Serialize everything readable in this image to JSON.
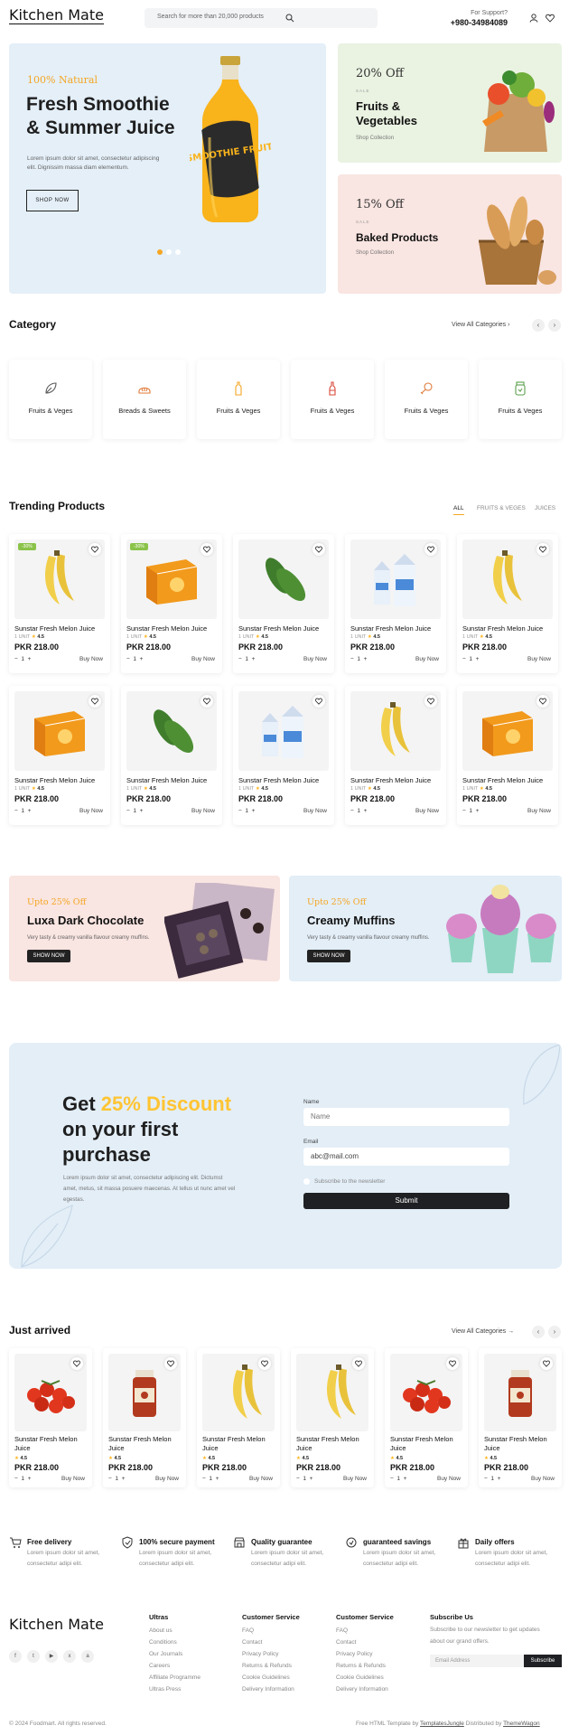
{
  "header": {
    "logo": "Kitchen Mate",
    "search_placeholder": "Search for more than 20,000 products",
    "support_label": "For Support?",
    "support_phone": "+980-34984089"
  },
  "hero": {
    "kicker": "100% Natural",
    "title_line1": "Fresh Smoothie",
    "title_line2": "& Summer Juice",
    "desc_line1": "Lorem ipsum dolor sit amet, consectetur adipiscing",
    "desc_line2": "elit. Dignissim massa diam elementum.",
    "cta": "SHOP NOW",
    "bottle_text": "SMOOTHIE FRUIT"
  },
  "promos": [
    {
      "off": "20% Off",
      "sale": "SALE",
      "title_line1": "Fruits &",
      "title_line2": "Vegetables",
      "link": "Shop Collection"
    },
    {
      "off": "15% Off",
      "sale": "SALE",
      "title_line1": "Baked Products",
      "title_line2": "",
      "link": "Shop Collection"
    }
  ],
  "category": {
    "title": "Category",
    "view_all": "View All Categories",
    "items": [
      {
        "label": "Fruits & Veges",
        "icon": "leaf-icon"
      },
      {
        "label": "Breads & Sweets",
        "icon": "bread-icon"
      },
      {
        "label": "Fruits & Veges",
        "icon": "bottle-icon"
      },
      {
        "label": "Fruits & Veges",
        "icon": "wine-icon"
      },
      {
        "label": "Fruits & Veges",
        "icon": "drumstick-icon"
      },
      {
        "label": "Fruits & Veges",
        "icon": "jar-icon"
      }
    ]
  },
  "trending": {
    "title": "Trending Products",
    "tabs": [
      "ALL",
      "FRUITS & VEGES",
      "JUICES"
    ],
    "product": {
      "name": "Sunstar Fresh Melon Juice",
      "unit": "1 UNIT",
      "rating": "4.5",
      "price": "PKR 218.00",
      "qty": "1",
      "buy": "Buy Now",
      "badge": "-30%"
    }
  },
  "banners": [
    {
      "upto": "Upto 25% Off",
      "title": "Luxa Dark Chocolate",
      "desc": "Very tasty & creamy vanilla flavour creamy muffins.",
      "cta": "SHOW NOW"
    },
    {
      "upto": "Upto 25% Off",
      "title": "Creamy Muffins",
      "desc": "Very tasty & creamy vanilla flavour creamy muffins.",
      "cta": "SHOW NOW"
    }
  ],
  "discount": {
    "get": "Get ",
    "highlight": "25% Discount",
    "line2": "on your first",
    "line3": "purchase",
    "desc_line1": "Lorem ipsum dolor sit amet, consectetur adipiscing elit. Dictumst",
    "desc_line2": "amet, metus, sit massa posuere maecenas. At tellus ut nunc amet vel",
    "desc_line3": "egestas.",
    "name_label": "Name",
    "name_placeholder": "Name",
    "email_label": "Email",
    "email_value": "abc@mail.com",
    "subscribe_label": "Subscribe to the newsletter",
    "submit": "Submit"
  },
  "just_arrived": {
    "title": "Just arrived",
    "view_all": "View All Categories",
    "product": {
      "name_line1": "Sunstar Fresh Melon",
      "name_line2": "Juice",
      "rating": "4.5",
      "price": "PKR 218.00",
      "qty": "1",
      "buy": "Buy Now"
    }
  },
  "features": [
    {
      "title": "Free delivery",
      "icon": "cart-icon"
    },
    {
      "title": "100% secure payment",
      "icon": "shield-icon"
    },
    {
      "title": "Quality guarantee",
      "icon": "store-icon"
    },
    {
      "title": "guaranteed savings",
      "icon": "savings-icon"
    },
    {
      "title": "Daily offers",
      "icon": "gift-icon"
    }
  ],
  "feature_desc_line1": "Lorem ipsum dolor sit amet,",
  "feature_desc_line2": "consectetur adipi elit.",
  "footer": {
    "logo": "Kitchen Mate",
    "cols": [
      {
        "title": "Ultras",
        "links": [
          "About us",
          "Conditions",
          "Our Journals",
          "Careers",
          "Affiliate Programme",
          "Ultras Press"
        ]
      },
      {
        "title": "Customer Service",
        "links": [
          "FAQ",
          "Contact",
          "Privacy Policy",
          "Returns & Refunds",
          "Cookie Guidelines",
          "Delivery Information"
        ]
      },
      {
        "title": "Customer Service",
        "links": [
          "FAQ",
          "Contact",
          "Privacy Policy",
          "Returns & Refunds",
          "Cookie Guidelines",
          "Delivery Information"
        ]
      }
    ],
    "subscribe_title": "Subscribe Us",
    "subscribe_desc_line1": "Subscribe to our newsletter to get updates",
    "subscribe_desc_line2": "about our grand offers.",
    "email_placeholder": "Email Address",
    "subscribe_button": "Subscribe",
    "copyright": "© 2024 Foodmart. All rights reserved.",
    "credit_prefix": "Free HTML Template by ",
    "credit_link1": "TemplatesJungle",
    "credit_mid": " Distributed by ",
    "credit_link2": "ThemeWagon"
  },
  "colors": {
    "accent": "#ffc433",
    "dark": "#1f2023",
    "hero_bg": "#e4eff8",
    "green_card": "#eaf3e2",
    "pink_card": "#f9e5e1"
  }
}
